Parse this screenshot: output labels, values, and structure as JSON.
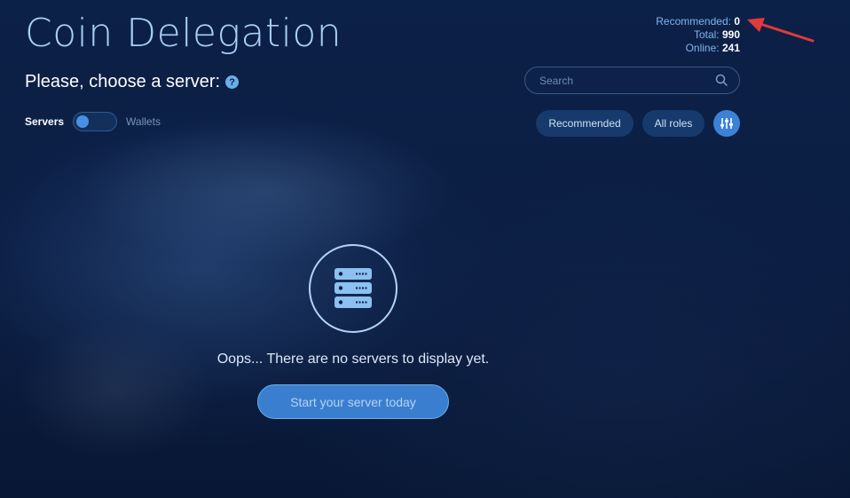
{
  "page": {
    "title": "Coin Delegation",
    "subtitle": "Please, choose a server:"
  },
  "stats": {
    "recommended_label": "Recommended:",
    "recommended_value": "0",
    "total_label": "Total:",
    "total_value": "990",
    "online_label": "Online:",
    "online_value": "241"
  },
  "search": {
    "placeholder": "Search",
    "value": ""
  },
  "toggle": {
    "left_label": "Servers",
    "right_label": "Wallets",
    "selected": "Servers"
  },
  "filters": {
    "recommended_label": "Recommended",
    "roles_label": "All roles"
  },
  "empty_state": {
    "message": "Oops... There are no servers to display yet.",
    "cta_label": "Start your server today"
  },
  "icons": {
    "help": "question-circle-icon",
    "search": "search-icon",
    "filter": "sliders-icon",
    "server": "server-stack-icon",
    "annotation": "red-arrow-icon"
  },
  "colors": {
    "background": "#0b1d42",
    "title": "#a9cff2",
    "accent": "#3b82d6",
    "stat_label": "#7fb4f0",
    "annotation_arrow": "#e03a3a"
  }
}
